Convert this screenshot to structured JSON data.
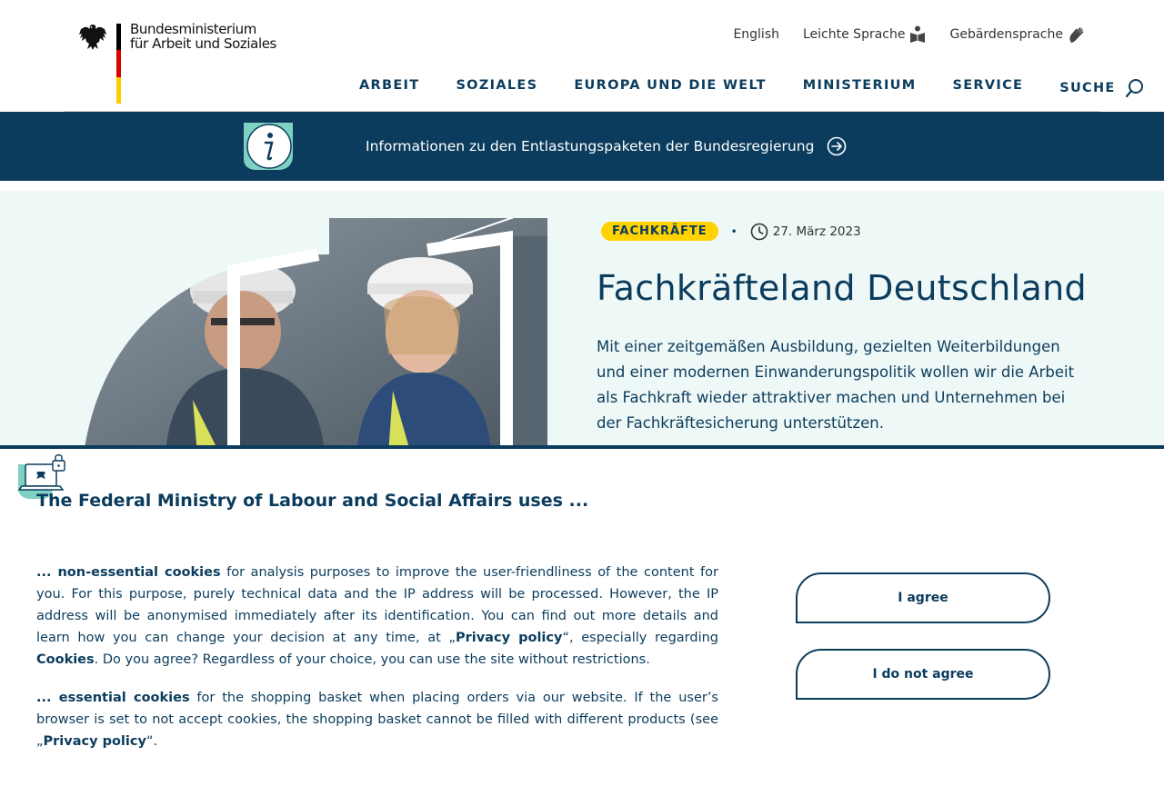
{
  "header": {
    "logo_line1": "Bundesministerium",
    "logo_line2": "für Arbeit und Soziales",
    "lang_links": {
      "english": "English",
      "easy_language": "Leichte Sprache",
      "sign_language": "Gebärdensprache"
    },
    "nav": [
      "ARBEIT",
      "SOZIALES",
      "EUROPA UND DIE WELT",
      "MINISTERIUM",
      "SERVICE",
      "SUCHE"
    ]
  },
  "banner": {
    "text": "Informationen zu den Entlastungspaketen der Bundesregierung"
  },
  "hero": {
    "tag": "FACHKRÄFTE",
    "separator": "•",
    "date": "27. März 2023",
    "title": "Fachkräfteland Deutschland",
    "text": "Mit einer zeitgemäßen Ausbildung, gezielten Weiterbildungen und einer modernen Einwanderungspolitik wollen wir die Arbeit als Fachkraft wieder attraktiver machen und Unternehmen bei der Fachkräftesicherung unterstützen."
  },
  "cookie": {
    "title": "The Federal Ministry of Labour and Social Affairs uses ...",
    "p1_lead": "... non-essential cookies",
    "p1_a": " for analysis purposes to improve the user-friendliness of the content for you. For this purpose, purely technical data and the IP address will be processed. However, the IP address will be anonymised immediately after its identification. You can find out more details and learn how you can change your decision at any time, at „",
    "p1_link1": "Privacy policy",
    "p1_b": "“, especially regarding ",
    "p1_link2": "Cookies",
    "p1_c": ". Do you agree? Regardless of your choice, you can use the site without restrictions.",
    "p2_lead": "... essential cookies",
    "p2_a": " for the shopping basket when placing orders via our website. If the user’s browser is set to not accept cookies, the shopping basket cannot be filled with different products (see „",
    "p2_link": "Privacy policy",
    "p2_b": "“.",
    "agree_label": "I agree",
    "disagree_label": "I do not agree"
  },
  "colors": {
    "brand_blue": "#0b3c5d",
    "tag_yellow": "#ffd200",
    "hero_bg": "#eef8f6",
    "accent_mint": "#7fd1c3"
  },
  "icons": {
    "eagle": "federal-eagle-icon",
    "easy_language": "reading-person-icon",
    "sign_language": "sign-hand-icon",
    "search": "search-icon",
    "info": "info-icon",
    "arrow": "circle-arrow-right-icon",
    "clock": "clock-icon",
    "privacy": "laptop-lock-icon"
  }
}
